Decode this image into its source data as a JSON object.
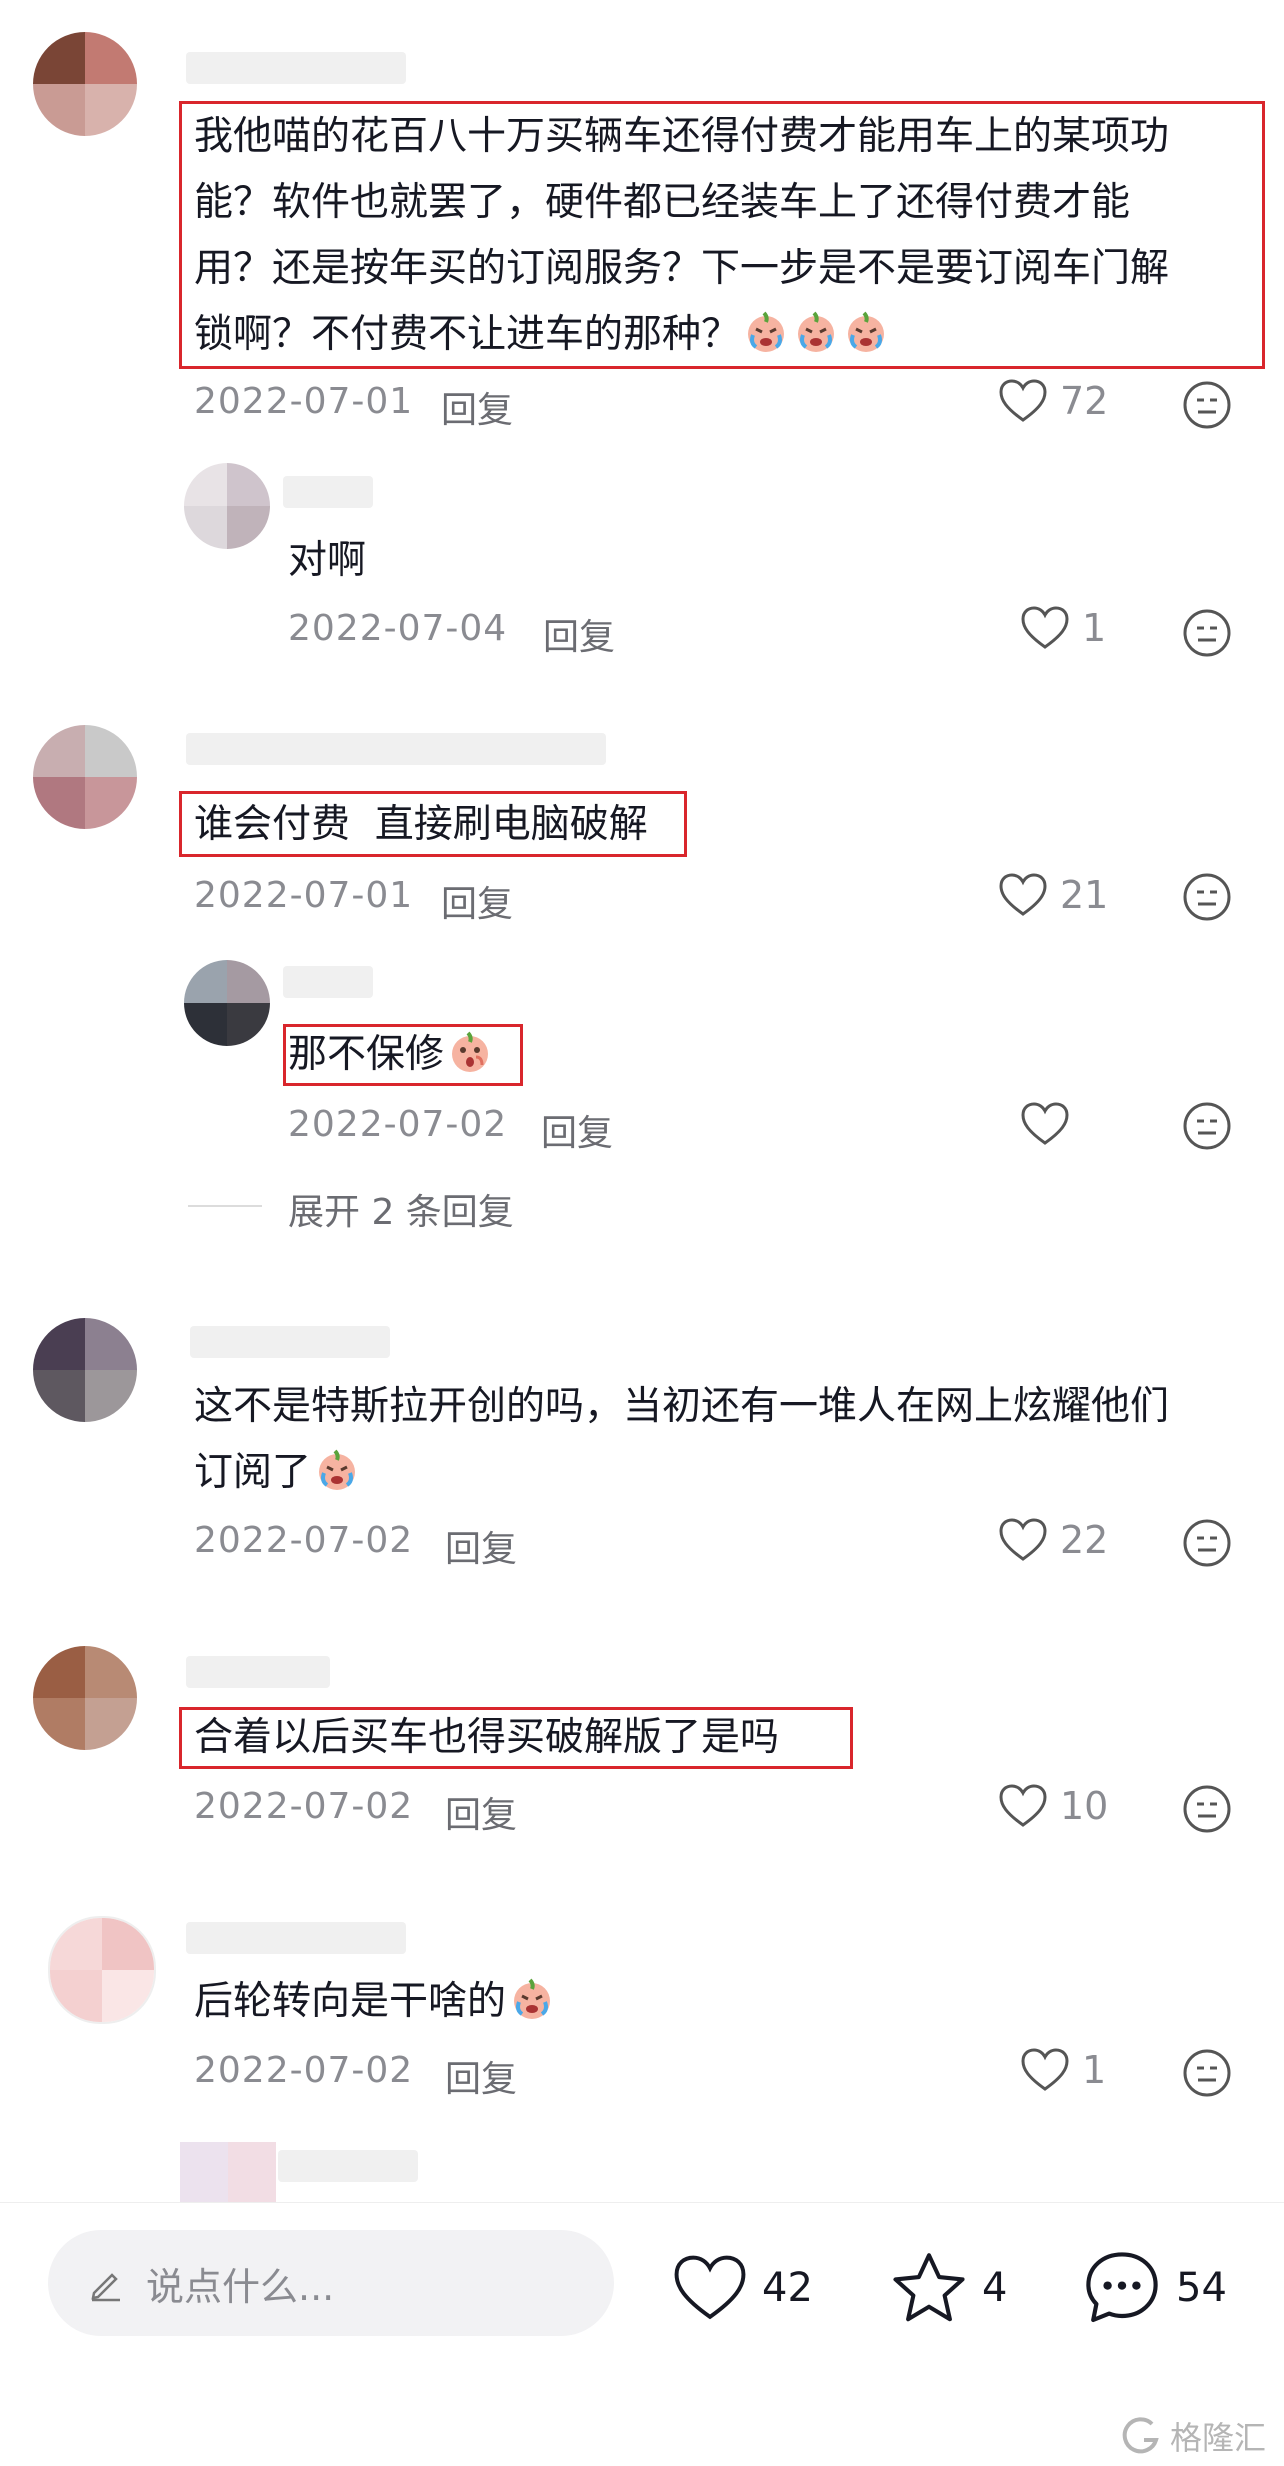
{
  "comments": [
    {
      "text_lines": [
        "我他喵的花百八十万买辆车还得付费才能用车上的某项功",
        "能？软件也就罢了，硬件都已经装车上了还得付费才能",
        "用？还是按年买的订阅服务？下一步是不是要订阅车门解",
        "锁啊？不付费不让进车的那种？"
      ],
      "date": "2022-07-01",
      "reply": "回复",
      "likes": "72"
    },
    {
      "text": "对啊",
      "date": "2022-07-04",
      "reply": "回复",
      "likes": "1"
    },
    {
      "text": "谁会付费  直接刷电脑破解",
      "date": "2022-07-01",
      "reply": "回复",
      "likes": "21"
    },
    {
      "text": "那不保修",
      "date": "2022-07-02",
      "reply": "回复",
      "likes": ""
    },
    {
      "text_lines": [
        "这不是特斯拉开创的吗，当初还有一堆人在网上炫耀他们",
        "订阅了"
      ],
      "date": "2022-07-02",
      "reply": "回复",
      "likes": "22"
    },
    {
      "text": "合着以后买车也得买破解版了是吗",
      "date": "2022-07-02",
      "reply": "回复",
      "likes": "10"
    },
    {
      "text": "后轮转向是干啥的",
      "date": "2022-07-02",
      "reply": "回复",
      "likes": "1"
    }
  ],
  "expand_replies": "展开 2 条回复",
  "bottom_bar": {
    "input_placeholder": "说点什么...",
    "like_count": "42",
    "favorite_count": "4",
    "comment_count": "54"
  },
  "watermark": "格隆汇",
  "colors": {
    "highlight": "#d9262c",
    "meta": "#8a8b91"
  }
}
